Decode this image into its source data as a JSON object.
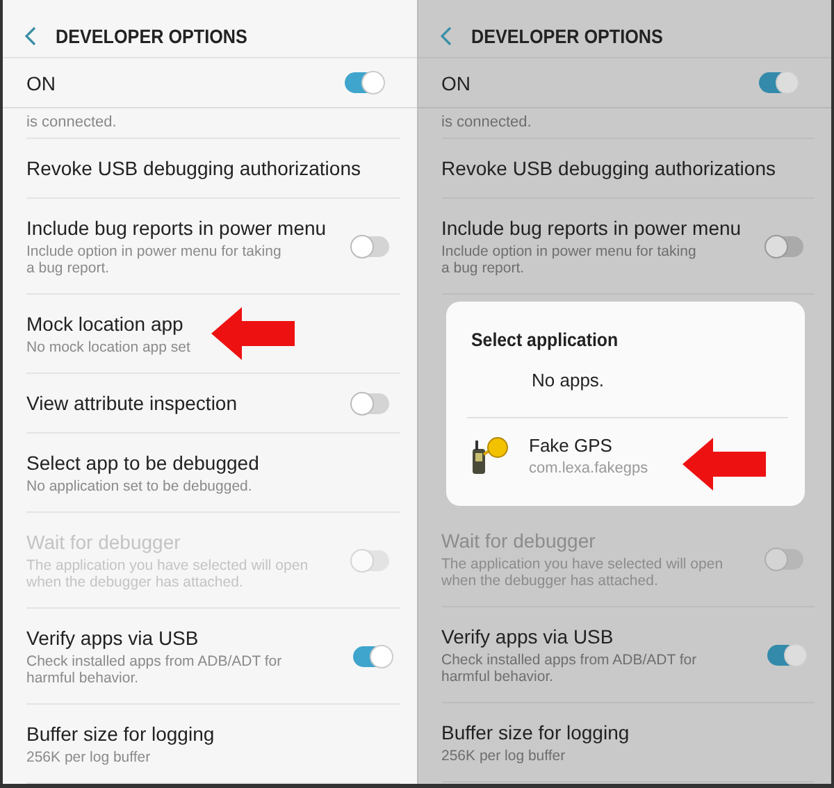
{
  "panels": [
    {
      "dimmed": false,
      "header": {
        "title": "DEVELOPER OPTIONS"
      },
      "master": {
        "label": "ON",
        "on": true
      },
      "items": [
        {
          "kind": "fragment",
          "title": "is connected."
        },
        {
          "kind": "plain",
          "title": "Revoke USB debugging authorizations"
        },
        {
          "kind": "toggle",
          "title": "Include bug reports in power menu",
          "subtitle": [
            "Include option in power menu for taking",
            "a bug report."
          ],
          "on": false,
          "disabled": false
        },
        {
          "kind": "plain",
          "title": "Mock location app",
          "subtitle": [
            "No mock location app set"
          ],
          "highlighted": true
        },
        {
          "kind": "toggle",
          "title": "View attribute inspection",
          "on": false,
          "disabled": false
        },
        {
          "kind": "plain",
          "title": "Select app to be debugged",
          "subtitle": [
            "No application set to be debugged."
          ]
        },
        {
          "kind": "toggle",
          "title": "Wait for debugger",
          "subtitle": [
            "The application you have selected will open",
            "when the debugger has attached."
          ],
          "on": false,
          "disabled": true
        },
        {
          "kind": "toggle",
          "title": "Verify apps via USB",
          "subtitle": [
            "Check installed apps from ADB/ADT for",
            "harmful behavior."
          ],
          "on": true,
          "disabled": false
        },
        {
          "kind": "plain",
          "title": "Buffer size for logging",
          "subtitle": [
            "256K per log buffer"
          ]
        }
      ]
    },
    {
      "dimmed": true,
      "header": {
        "title": "DEVELOPER OPTIONS"
      },
      "master": {
        "label": "ON",
        "on": true
      },
      "items": [
        {
          "kind": "fragment",
          "title": "is connected."
        },
        {
          "kind": "plain",
          "title": "Revoke USB debugging authorizations"
        },
        {
          "kind": "toggle",
          "title": "Include bug reports in power menu",
          "subtitle": [
            "Include option in power menu for taking",
            "a bug report."
          ],
          "on": false,
          "disabled": false
        },
        {
          "kind": "dialog",
          "title": "Select application",
          "empty_text": "No apps.",
          "apps": [
            {
              "name": "Fake GPS",
              "package": "com.lexa.fakegps",
              "highlighted": true
            }
          ]
        },
        {
          "kind": "toggle",
          "title": "Wait for debugger",
          "subtitle": [
            "The application you have selected will open",
            "when the debugger has attached."
          ],
          "on": false,
          "disabled": true
        },
        {
          "kind": "toggle",
          "title": "Verify apps via USB",
          "subtitle": [
            "Check installed apps from ADB/ADT for",
            "harmful behavior."
          ],
          "on": true,
          "disabled": false
        },
        {
          "kind": "plain",
          "title": "Buffer size for logging",
          "subtitle": [
            "256K per log buffer"
          ]
        }
      ]
    }
  ]
}
